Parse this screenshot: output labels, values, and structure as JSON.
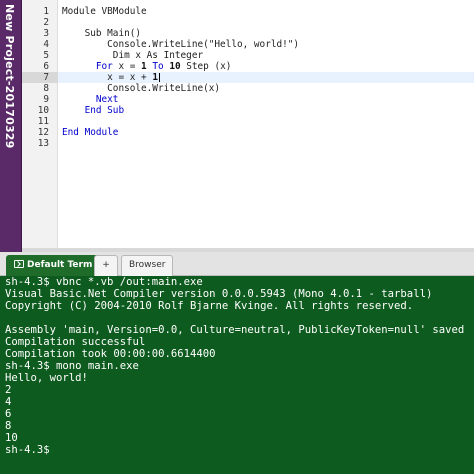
{
  "project": {
    "title": "New Project-20170329"
  },
  "editor": {
    "active_line": 7,
    "lines": [
      {
        "n": "1",
        "segments": [
          {
            "t": "Module VBModule",
            "c": ""
          }
        ]
      },
      {
        "n": "2",
        "segments": []
      },
      {
        "n": "3",
        "segments": [
          {
            "t": "    Sub Main()",
            "c": ""
          }
        ]
      },
      {
        "n": "4",
        "segments": [
          {
            "t": "        Console.WriteLine(\"Hello, world!\")",
            "c": ""
          }
        ]
      },
      {
        "n": "5",
        "segments": [
          {
            "t": "         Dim x As Integer",
            "c": ""
          }
        ]
      },
      {
        "n": "6",
        "segments": [
          {
            "t": "      ",
            "c": ""
          },
          {
            "t": "For",
            "c": "kw"
          },
          {
            "t": " x = ",
            "c": ""
          },
          {
            "t": "1",
            "c": "num"
          },
          {
            "t": " ",
            "c": ""
          },
          {
            "t": "To",
            "c": "kw"
          },
          {
            "t": " ",
            "c": ""
          },
          {
            "t": "10",
            "c": "num"
          },
          {
            "t": " Step (x)",
            "c": ""
          }
        ]
      },
      {
        "n": "7",
        "segments": [
          {
            "t": "        x = x + ",
            "c": ""
          },
          {
            "t": "1",
            "c": "num"
          }
        ]
      },
      {
        "n": "8",
        "segments": [
          {
            "t": "        Console.WriteLine(x)",
            "c": ""
          }
        ]
      },
      {
        "n": "9",
        "segments": [
          {
            "t": "      ",
            "c": ""
          },
          {
            "t": "Next",
            "c": "kw"
          }
        ]
      },
      {
        "n": "10",
        "segments": [
          {
            "t": "    ",
            "c": ""
          },
          {
            "t": "End Sub",
            "c": "kw"
          }
        ]
      },
      {
        "n": "11",
        "segments": []
      },
      {
        "n": "12",
        "segments": [
          {
            "t": "End Module",
            "c": "kw"
          }
        ]
      },
      {
        "n": "13",
        "segments": []
      }
    ]
  },
  "tabs": {
    "default_term": "Default Term",
    "add": "+",
    "browser": "Browser"
  },
  "terminal": {
    "lines": [
      "sh-4.3$ vbnc *.vb /out:main.exe",
      "Visual Basic.Net Compiler version 0.0.0.5943 (Mono 4.0.1 - tarball)",
      "Copyright (C) 2004-2010 Rolf Bjarne Kvinge. All rights reserved.",
      "",
      "Assembly 'main, Version=0.0, Culture=neutral, PublicKeyToken=null' saved",
      "Compilation successful",
      "Compilation took 00:00:00.6614400",
      "sh-4.3$ mono main.exe",
      "Hello, world!",
      "2",
      "4",
      "6",
      "8",
      "10",
      "sh-4.3$"
    ]
  },
  "colors": {
    "project_bar": "#5a2a68",
    "terminal_bg": "#0d5b1e",
    "active_tab": "#1e6b2a",
    "keyword": "#0000cc"
  }
}
